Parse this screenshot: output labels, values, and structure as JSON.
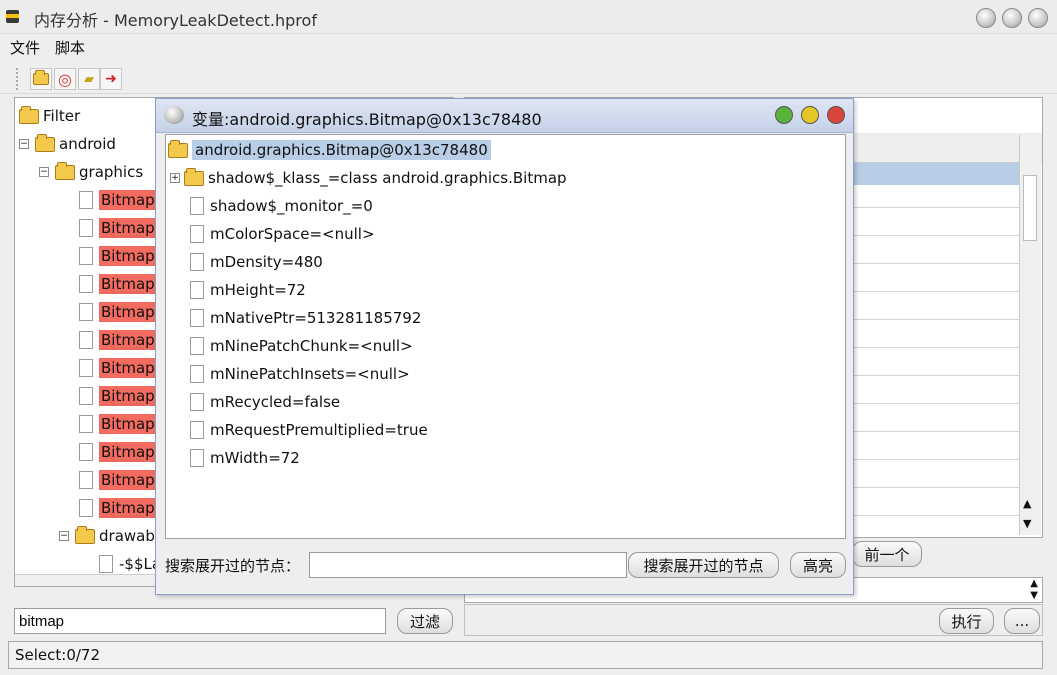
{
  "window": {
    "title": "内存分析 - MemoryLeakDetect.hprof"
  },
  "menu": [
    "文件",
    "脚本"
  ],
  "left_tree": {
    "root": "Filter",
    "android": "android",
    "graphics": "graphics",
    "bitmap_items": [
      "Bitmap[",
      "BitmapS",
      "BitmapS",
      "BitmapS",
      "BitmapS",
      "BitmapS",
      "BitmapS",
      "BitmapF",
      "BitmapF",
      "BitmapF",
      "BitmapS",
      "Bitmap["
    ],
    "drawable": "drawab",
    "sub_item": "-$$La"
  },
  "filter": {
    "value": "bitmap",
    "button": "过滤"
  },
  "right_panel": {
    "prev_button": "前一个",
    "run_button": "执行",
    "more_button": "..."
  },
  "status": "Select:0/72",
  "dialog": {
    "title": "变量:android.graphics.Bitmap@0x13c78480",
    "root": "android.graphics.Bitmap@0x13c78480",
    "fields": [
      {
        "label": "shadow$_klass_=class android.graphics.Bitmap",
        "type": "folder"
      },
      {
        "label": "shadow$_monitor_=0",
        "type": "leaf"
      },
      {
        "label": "mColorSpace=<null>",
        "type": "leaf"
      },
      {
        "label": "mDensity=480",
        "type": "leaf"
      },
      {
        "label": "mHeight=72",
        "type": "leaf"
      },
      {
        "label": "mNativePtr=513281185792",
        "type": "leaf"
      },
      {
        "label": "mNinePatchChunk=<null>",
        "type": "leaf"
      },
      {
        "label": "mNinePatchInsets=<null>",
        "type": "leaf"
      },
      {
        "label": "mRecycled=false",
        "type": "leaf"
      },
      {
        "label": "mRequestPremultiplied=true",
        "type": "leaf"
      },
      {
        "label": "mWidth=72",
        "type": "leaf"
      }
    ],
    "search_label": "搜索展开过的节点：",
    "search_value": "",
    "search_button": "搜索展开过的节点",
    "highlight_button": "高亮"
  },
  "colors": {
    "highlight_red": "#f36b5f",
    "selection_blue": "#b8cde6",
    "dlg_green": "#58b33b",
    "dlg_yellow": "#e7c727",
    "dlg_red": "#d9453d"
  }
}
